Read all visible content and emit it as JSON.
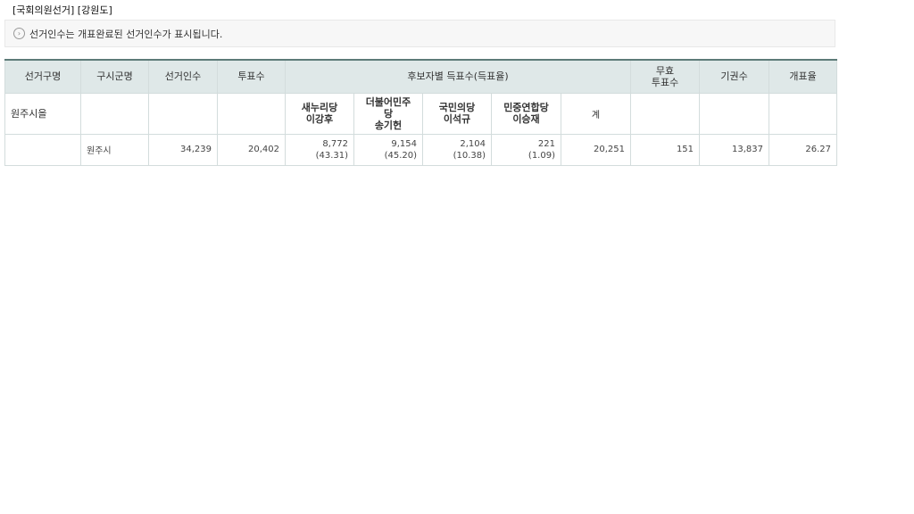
{
  "page": {
    "title": "[국회의원선거] [강원도]",
    "notice": "선거인수는 개표완료된 선거인수가 표시됩니다.",
    "notice_icon": "circle-arrow-right-icon"
  },
  "table": {
    "headers": {
      "district": "선거구명",
      "municipality": "구시군명",
      "electors": "선거인수",
      "voters": "투표수",
      "candidate_votes": "후보자별 득표수(득표율)",
      "invalid_line1": "무효",
      "invalid_line2": "투표수",
      "abstentions": "기권수",
      "count_rate": "개표율"
    },
    "district_name": "원주시을",
    "candidates": [
      {
        "party": "새누리당",
        "name": "이강후"
      },
      {
        "party": "더불어민주",
        "party2": "당",
        "name": "송기헌"
      },
      {
        "party": "국민의당",
        "name": "이석규"
      },
      {
        "party": "민중연합당",
        "name": "이승재"
      }
    ],
    "total_label": "계",
    "row": {
      "municipality": "원주시",
      "electors": "34,239",
      "voters": "20,402",
      "votes": [
        {
          "count": "8,772",
          "rate": "(43.31)"
        },
        {
          "count": "9,154",
          "rate": "(45.20)"
        },
        {
          "count": "2,104",
          "rate": "(10.38)"
        },
        {
          "count": "221",
          "rate": "(1.09)"
        }
      ],
      "total": "20,251",
      "invalid": "151",
      "abstentions": "13,837",
      "count_rate": "26.27"
    }
  },
  "colors": {
    "header_bg": "#dfe8e8",
    "header_top_border": "#5d7b78",
    "grid": "#d3dcdc",
    "notice_bg": "#f7f7f7"
  }
}
